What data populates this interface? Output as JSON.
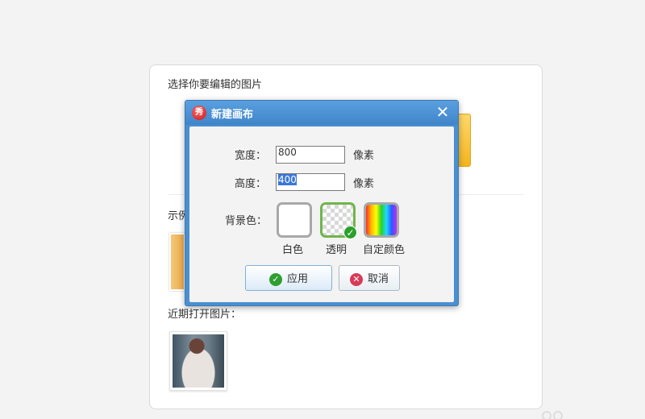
{
  "background_panel": {
    "title": "选择你要编辑的图片",
    "example_label": "示例",
    "recent_label": "近期打开图片："
  },
  "dialog": {
    "logo_text": "秀",
    "title": "新建画布",
    "close_glyph": "✕",
    "width_label": "宽度：",
    "width_value": "800",
    "height_label": "高度：",
    "height_value": "400",
    "unit": "像素",
    "bg_label": "背景色：",
    "swatches": [
      {
        "label": "白色"
      },
      {
        "label": "透明",
        "selected": true
      },
      {
        "label": "自定颜色"
      }
    ],
    "check_glyph": "✓",
    "apply_label": "应用",
    "apply_icon": "✓",
    "cancel_label": "取消",
    "cancel_icon": "✕"
  },
  "colors": {
    "titlebar": "#4a8fd1",
    "selected_border": "#6fb64b",
    "apply_icon": "#2f9e2f",
    "cancel_icon": "#d83a57"
  },
  "icons": [
    "app-logo-icon",
    "close-icon",
    "check-icon",
    "cancel-icon"
  ]
}
